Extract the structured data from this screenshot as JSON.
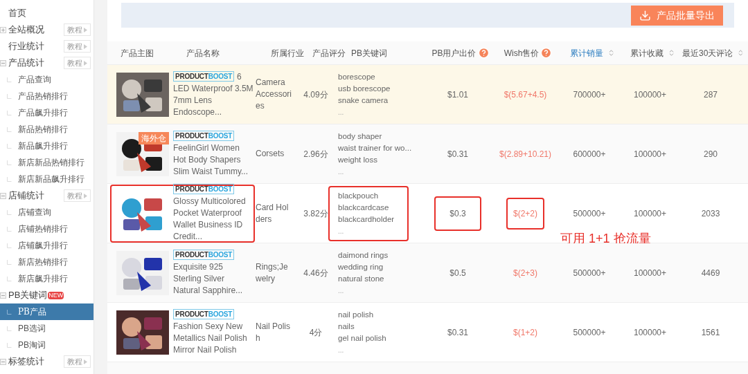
{
  "sidebar": {
    "items": [
      {
        "label": "首页"
      },
      {
        "label": "全站概况",
        "expanded": false,
        "tutorial": "教程"
      },
      {
        "label": "行业统计",
        "tutorial": "教程"
      },
      {
        "label": "产品统计",
        "expanded": true,
        "tutorial": "教程",
        "children": [
          {
            "label": "产品查询",
            "selected": false
          },
          {
            "label": "产品热销排行",
            "selected": false
          },
          {
            "label": "产品飙升排行",
            "selected": false
          },
          {
            "label": "新品热销排行",
            "selected": false
          },
          {
            "label": "新品飙升排行",
            "selected": false
          },
          {
            "label": "新店新品热销排行",
            "selected": false
          },
          {
            "label": "新店新品飙升排行",
            "selected": false
          }
        ]
      },
      {
        "label": "店铺统计",
        "expanded": true,
        "tutorial": "教程",
        "children": [
          {
            "label": "店铺查询",
            "selected": false
          },
          {
            "label": "店铺热销排行",
            "selected": false
          },
          {
            "label": "店铺飙升排行",
            "selected": false
          },
          {
            "label": "新店热销排行",
            "selected": false
          },
          {
            "label": "新店飙升排行",
            "selected": false
          }
        ]
      },
      {
        "label": "PB关键词",
        "expanded": true,
        "badge": "NEW",
        "children": [
          {
            "label": "PB产品",
            "selected": true
          },
          {
            "label": "PB选词",
            "selected": false
          },
          {
            "label": "PB淘词",
            "selected": false
          }
        ]
      },
      {
        "label": "标签统计",
        "expanded": true,
        "tutorial": "教程"
      }
    ]
  },
  "toolbar": {
    "export_button": "产品批量导出"
  },
  "table": {
    "columns": [
      {
        "label": "产品主图"
      },
      {
        "label": "产品名称"
      },
      {
        "label": "所属行业"
      },
      {
        "label": "产品评分"
      },
      {
        "label": "PB关键词"
      },
      {
        "label": "PB用户出价",
        "help": true
      },
      {
        "label": "Wish售价",
        "help": true
      },
      {
        "label": "累计销量",
        "sortable": true,
        "selected": true
      },
      {
        "label": "累计收藏",
        "sortable": true,
        "selected": false
      },
      {
        "label": "最近30天评论",
        "sortable": true,
        "selected": false
      }
    ],
    "rows": [
      {
        "highlighted": true,
        "marked": false,
        "badge": [
          "PRODUCT",
          "BOOST"
        ],
        "name": "6 LED Waterproof 3.5M 7mm Lens Endoscope...",
        "industry": "Camera Accessori es",
        "rating": "4.09分",
        "keywords": [
          "borescope",
          "usb borescope",
          "snake camera"
        ],
        "more": "...",
        "pb_price": "$1.01",
        "wish_price": "$(5.67+4.5)",
        "sales": "700000+",
        "favorites": "100000+",
        "reviews": "287"
      },
      {
        "highlighted": false,
        "marked": false,
        "tag": "海外仓",
        "badge": [
          "PRODUCT",
          "BOOST"
        ],
        "name": "FeelinGirl Women Hot Body Shapers Slim Waist Tummy...",
        "industry": "Corsets",
        "rating": "2.96分",
        "keywords": [
          "body shaper",
          "waist trainer for wo...",
          "weight loss"
        ],
        "more": "...",
        "pb_price": "$0.31",
        "wish_price": "$(2.89+10.21)",
        "sales": "600000+",
        "favorites": "100000+",
        "reviews": "290"
      },
      {
        "highlighted": false,
        "marked": true,
        "note": "可用 1+1 抢流量",
        "badge": [
          "PRODUCT",
          "BOOST"
        ],
        "name": "Glossy Multicolored Pocket Waterproof Wallet Business ID Credit...",
        "industry": "Card Hol ders",
        "rating": "3.82分",
        "keywords": [
          "blackpouch",
          "blackcardcase",
          "blackcardholder"
        ],
        "more": "...",
        "pb_price": "$0.3",
        "wish_price": "$(2+2)",
        "sales": "500000+",
        "favorites": "100000+",
        "reviews": "2033"
      },
      {
        "highlighted": false,
        "marked": false,
        "badge": [
          "PRODUCT",
          "BOOST"
        ],
        "name": "Exquisite 925 Sterling Silver Natural Sapphire...",
        "industry": "Rings;Je welry",
        "rating": "4.46分",
        "keywords": [
          "daimond rings",
          "wedding ring",
          "natural stone"
        ],
        "more": "...",
        "pb_price": "$0.5",
        "wish_price": "$(2+3)",
        "sales": "500000+",
        "favorites": "100000+",
        "reviews": "4469"
      },
      {
        "highlighted": false,
        "marked": false,
        "badge": [
          "PRODUCT",
          "BOOST"
        ],
        "name": "Fashion Sexy New Metallics Nail Polish Mirror Nail Polish",
        "industry": "Nail Polis h",
        "rating": "4分",
        "keywords": [
          "nail polish",
          "nails",
          "gel nail polish"
        ],
        "more": "...",
        "pb_price": "$0.31",
        "wish_price": "$(1+2)",
        "sales": "500000+",
        "favorites": "100000+",
        "reviews": "1561"
      }
    ]
  }
}
